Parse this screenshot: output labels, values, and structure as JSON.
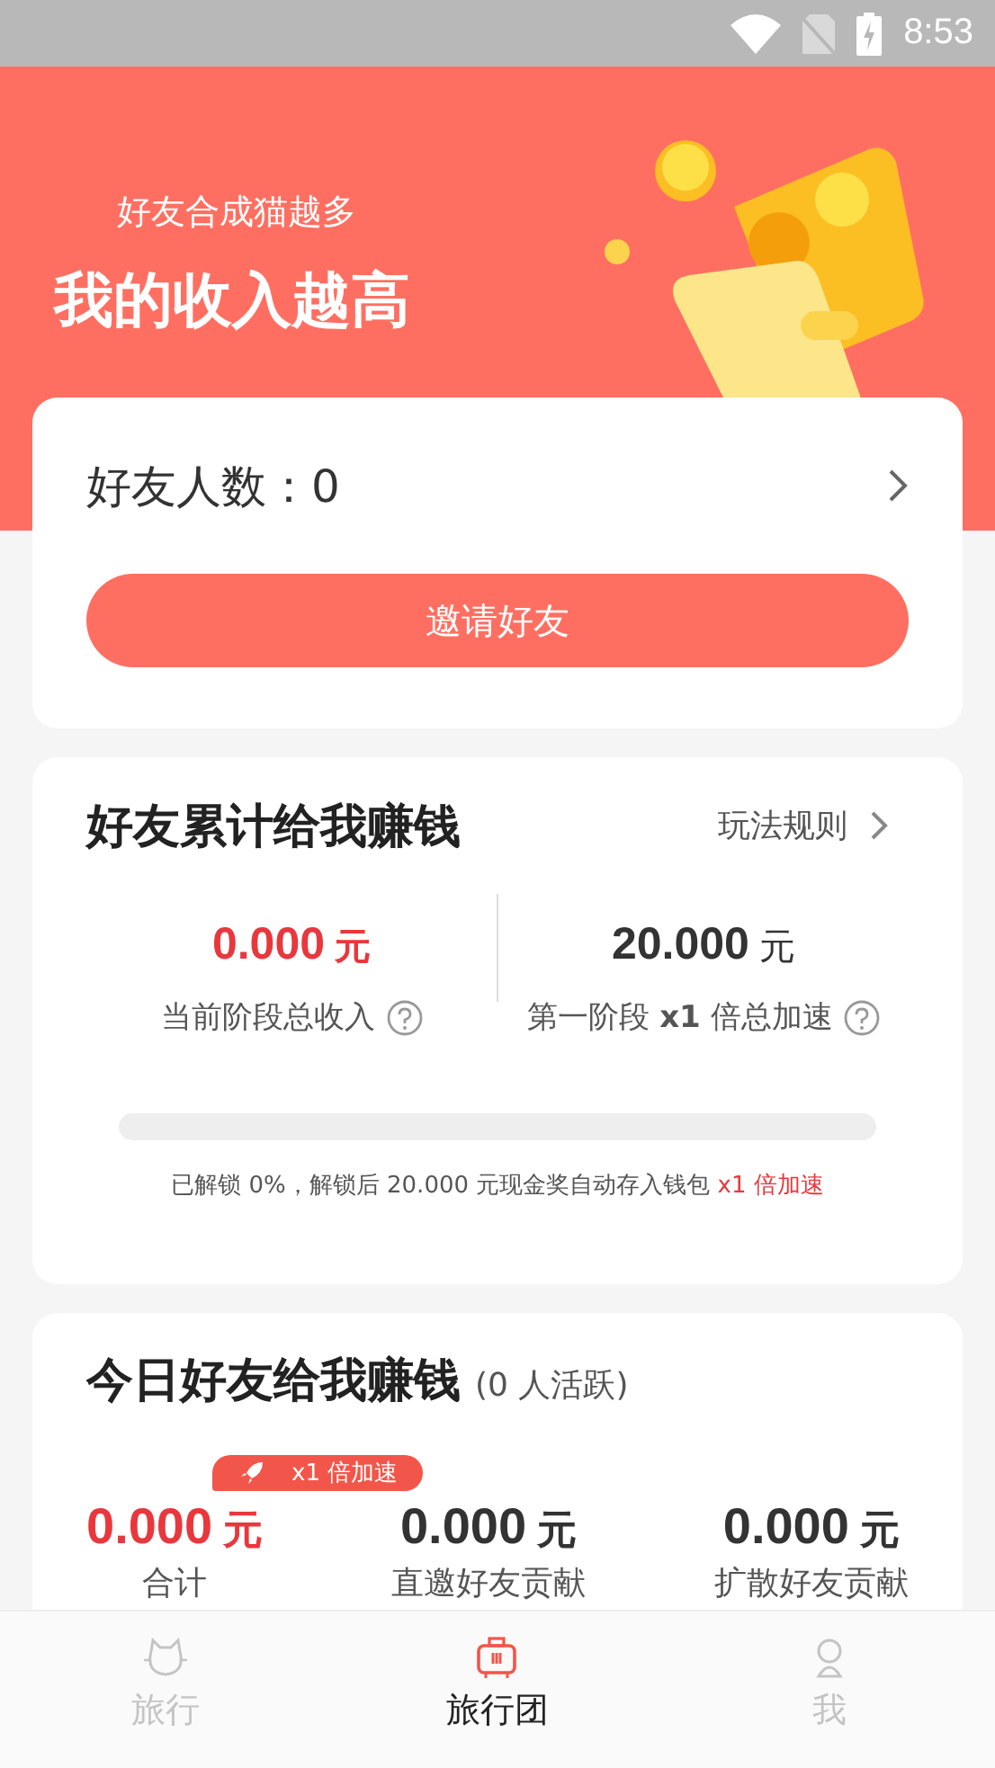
{
  "status_bar": {
    "time": "8:53"
  },
  "header": {
    "subtitle": "好友合成猫越多",
    "title": "我的收入越高"
  },
  "friends_card": {
    "label": "好友人数：0",
    "invite_button": "邀请好友"
  },
  "cumulative_card": {
    "title": "好友累计给我赚钱",
    "rules_link": "玩法规则",
    "current": {
      "amount": "0.000",
      "unit": "元",
      "label": "当前阶段总收入"
    },
    "target": {
      "amount": "20.000",
      "unit": "元",
      "label": "第一阶段 **x1** 倍总加速"
    },
    "progress": {
      "level": 0
    },
    "note": "已解锁 0%，解锁后 20.000 元现金奖自动存入钱包",
    "note_highlight": "x1 倍加速"
  },
  "today_card": {
    "title": "今日好友给我赚钱",
    "active_count": "(0 人活跃)",
    "badge": "x1 倍加速",
    "stats": [
      {
        "amount": "0.000",
        "unit": "元",
        "label": "合计",
        "highlight": true
      },
      {
        "amount": "0.000",
        "unit": "元",
        "label": "直邀好友贡献",
        "highlight": false
      },
      {
        "amount": "0.000",
        "unit": "元",
        "label": "扩散好友贡献",
        "highlight": false
      }
    ]
  },
  "tabs": [
    {
      "label": "旅行",
      "kind": "cat",
      "selected": false
    },
    {
      "label": "旅行团",
      "kind": "luggage",
      "selected": true
    },
    {
      "label": "我",
      "kind": "person",
      "selected": false
    }
  ]
}
